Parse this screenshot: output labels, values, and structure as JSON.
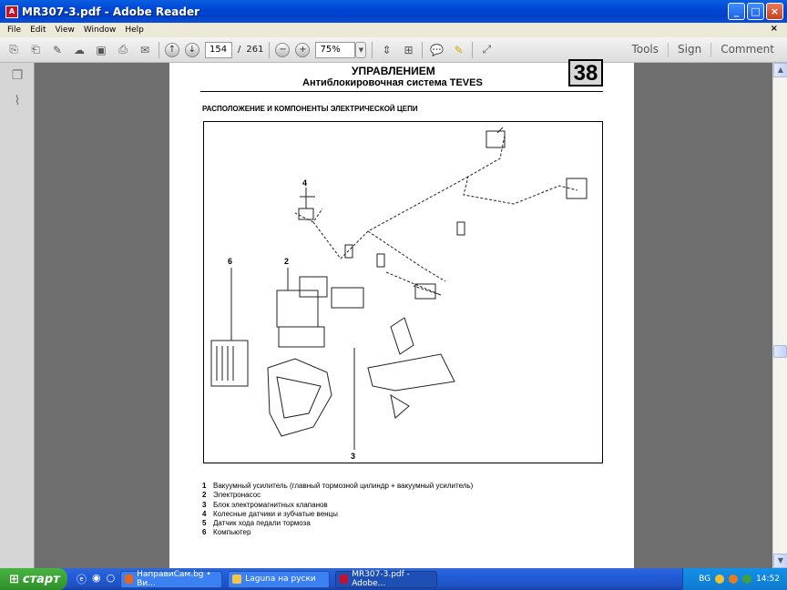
{
  "window": {
    "title": "MR307-3.pdf - Adobe Reader"
  },
  "menu": {
    "items": [
      "File",
      "Edit",
      "View",
      "Window",
      "Help"
    ],
    "close": "×"
  },
  "toolbar": {
    "page_current": "154",
    "page_sep": "/",
    "page_total": "261",
    "zoom": "75%",
    "right": [
      "Tools",
      "Sign",
      "Comment"
    ]
  },
  "document": {
    "header_line1": "УПРАВЛЕНИЕМ",
    "header_line2": "Антиблокировочная система TEVES",
    "page_badge": "38",
    "section_title": "РАСПОЛОЖЕНИЕ И КОМПОНЕНТЫ ЭЛЕКТРИЧЕСКОЙ ЦЕПИ",
    "figure_labels": [
      "4",
      "6",
      "2",
      "3"
    ],
    "legend": [
      {
        "num": "1",
        "text": "Вакуумный усилитель (главный тормозной цилиндр + вакуумный усилитель)"
      },
      {
        "num": "2",
        "text": "Электронасос"
      },
      {
        "num": "3",
        "text": "Блок электромагнитных клапанов"
      },
      {
        "num": "4",
        "text": "Колесные датчики и зубчатые венцы"
      },
      {
        "num": "5",
        "text": "Датчик хода педали тормоза"
      },
      {
        "num": "6",
        "text": "Компьютер"
      }
    ]
  },
  "taskbar": {
    "start": "старт",
    "tasks": [
      "НаправиСам.bg • Ви...",
      "Laguna на руски",
      "MR307-3.pdf - Adobe..."
    ],
    "lang": "BG",
    "clock": "14:52"
  }
}
